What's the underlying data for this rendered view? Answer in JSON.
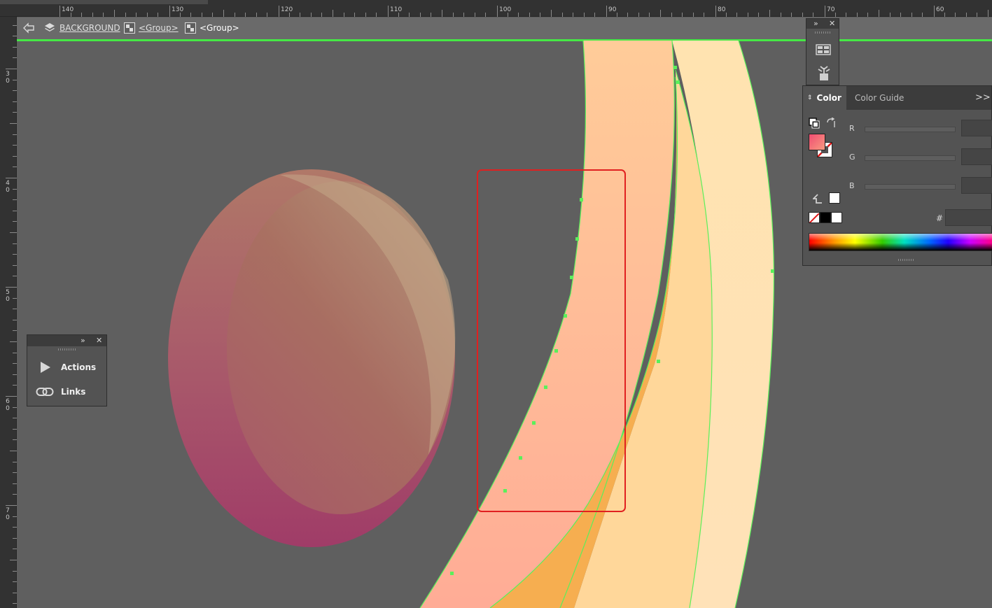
{
  "ruler": {
    "top_labels": [
      "140",
      "130",
      "120",
      "110",
      "100",
      "90",
      "80",
      "70",
      "60"
    ],
    "left_labels": [
      "3 0",
      "4 0",
      "5 0",
      "6 0",
      "7 0"
    ]
  },
  "breadcrumb": {
    "items": [
      {
        "label": "BACKGROUND",
        "icon": "layers-icon"
      },
      {
        "label": "<Group>",
        "icon": "group-icon"
      },
      {
        "label": "<Group>",
        "icon": "group-icon"
      }
    ],
    "isolation_border_color": "#45e845"
  },
  "side_panel": {
    "items": [
      {
        "label": "Actions",
        "icon": "play-icon"
      },
      {
        "label": "Links",
        "icon": "link-icon"
      }
    ]
  },
  "icon_strip": {
    "items": [
      {
        "icon": "swatch-library-icon"
      },
      {
        "icon": "symbols-icon"
      }
    ]
  },
  "color_panel": {
    "tabs": [
      {
        "label": "Color",
        "active": true
      },
      {
        "label": "Color Guide",
        "active": false
      }
    ],
    "channels": [
      {
        "label": "R",
        "value": ""
      },
      {
        "label": "G",
        "value": ""
      },
      {
        "label": "B",
        "value": ""
      }
    ],
    "hex_label": "#",
    "hex_value": "",
    "fill_gradient": [
      "#ef4d72",
      "#f99a80"
    ]
  },
  "canvas": {
    "selection_color": "#e02020",
    "path_color": "#5af05a",
    "background": "#5f5f5f"
  }
}
